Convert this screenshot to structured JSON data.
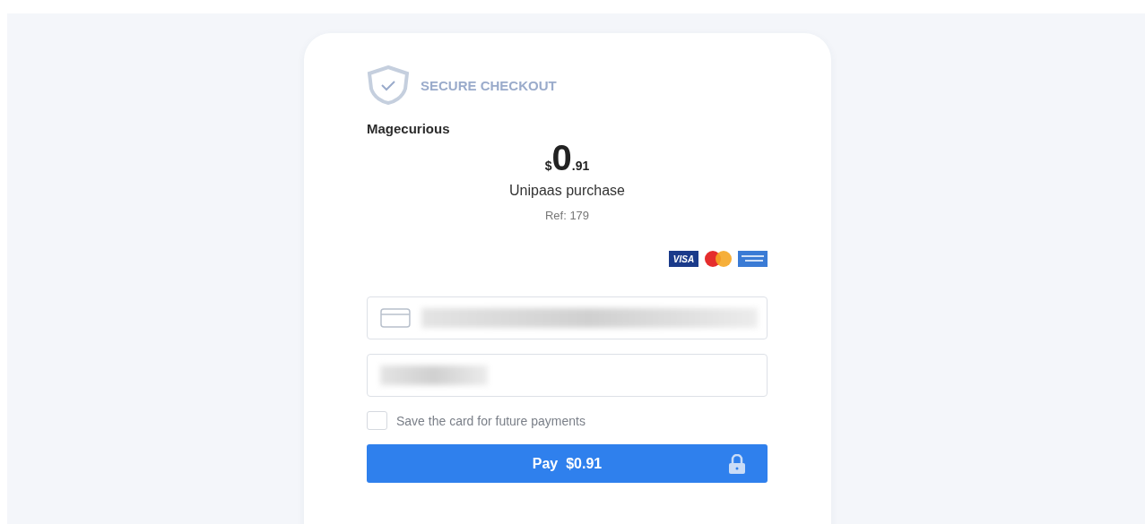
{
  "header": {
    "title": "SECURE CHECKOUT"
  },
  "merchant": "Magecurious",
  "amount": {
    "currency": "$",
    "whole": "0",
    "cents": ".91"
  },
  "description": "Unipaas purchase",
  "reference": "Ref: 179",
  "card_brands": [
    {
      "kind": "visa",
      "label": "VISA"
    },
    {
      "kind": "mastercard"
    },
    {
      "kind": "amex"
    }
  ],
  "fields": [
    {
      "kind": "card"
    },
    {
      "kind": "name"
    }
  ],
  "save_card": {
    "label": "Save the card for future payments",
    "checked": false
  },
  "pay_button": {
    "label": "Pay  $0.91"
  }
}
